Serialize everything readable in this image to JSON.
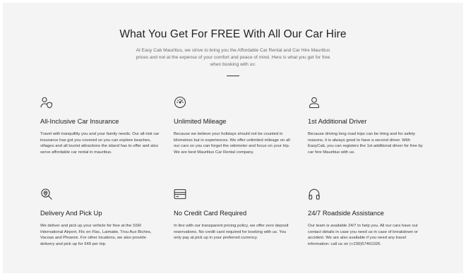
{
  "header": {
    "title": "What You Get For FREE With All Our Car Hire",
    "intro": "At Easy Cab Mauritius, we strive to bring you the Affordable Car Rental and Car Hire Mauritius prices and not at the expense of your comfort and peace of mind. Here is what you get for free when booking with us:"
  },
  "features": [
    {
      "icon": "shield-user-icon",
      "title": "All-Inclusive Car Insurance",
      "desc": "Travel with tranquillity you and your family needs. Our all-risk car insurance has got you covered so you can explore beaches, villages and all tourist attractions the island has to offer and also serve affordable car rental in mauritius."
    },
    {
      "icon": "speedometer-icon",
      "title": "Unlimited Mileage",
      "desc": "Because we believe your holidays should not be counted in kilometres but in experiences. We offer unlimited mileage on all our cars so you can forget the odometer and focus on your trip. We are best Mauritius Car Rental company."
    },
    {
      "icon": "user-icon",
      "title": "1st Additional Driver",
      "desc": "Because driving long road trips can be tiring and for safety reasons, it is always good to have a second driver. With EasyCab, you can registers the 1st additional driver for free by car hire Mauritius with us."
    },
    {
      "icon": "location-search-icon",
      "title": "Delivery And Pick Up",
      "desc": "We deliver and pick up your vehicle for free at the SSR International Airport, Flic en Flac, Laimatie, Trou Aux Biches, Vacoas and Phoenix. For other locations, we also provide delivery and pick up for €49 per trip."
    },
    {
      "icon": "credit-card-icon",
      "title": "No Credit Card Required",
      "desc": "In line with our transparent pricing policy, we offer zero deposit reservations. No credit card required for booking with us. You only pay at pick up in your preferred currency."
    },
    {
      "icon": "headphones-icon",
      "title": "24/7 Roadside Assistance",
      "desc": "Our team is available 24/7 to help you. All our cars have our contact details in case you need us in case of breakdown or accident. We are also available if you need any travel information: call us on (+230)57461026."
    }
  ]
}
